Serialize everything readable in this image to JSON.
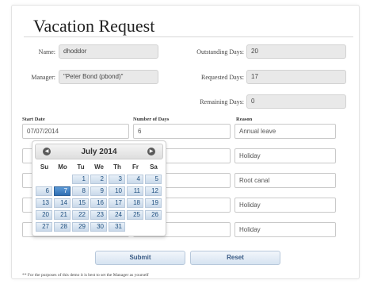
{
  "form": {
    "title": "Vacation Request",
    "name_label": "Name:",
    "name_value": "dhoddor",
    "manager_label": "Manager:",
    "manager_value": "\"Peter Bond (pbond)\"",
    "outstanding_label": "Outstanding Days:",
    "outstanding_value": "20",
    "requested_label": "Requested Days:",
    "requested_value": "17",
    "remaining_label": "Remaining Days:",
    "remaining_value": "0"
  },
  "table": {
    "headers": [
      "Start Date",
      "Number of Days",
      "Reason"
    ],
    "rows": [
      {
        "start": "07/07/2014",
        "days": "6",
        "reason": "Annual leave"
      },
      {
        "start": "",
        "days": "",
        "reason": "Holiday"
      },
      {
        "start": "",
        "days": "",
        "reason": "Root canal"
      },
      {
        "start": "",
        "days": "",
        "reason": "Holiday"
      },
      {
        "start": "",
        "days": "",
        "reason": "Holiday"
      }
    ]
  },
  "calendar": {
    "month_label": "July 2014",
    "weekdays": [
      "Su",
      "Mo",
      "Tu",
      "We",
      "Th",
      "Fr",
      "Sa"
    ],
    "weeks": [
      [
        "",
        "",
        "1",
        "2",
        "3",
        "4",
        "5"
      ],
      [
        "6",
        "7",
        "8",
        "9",
        "10",
        "11",
        "12"
      ],
      [
        "13",
        "14",
        "15",
        "16",
        "17",
        "18",
        "19"
      ],
      [
        "20",
        "21",
        "22",
        "23",
        "24",
        "25",
        "26"
      ],
      [
        "27",
        "28",
        "29",
        "30",
        "31",
        "",
        ""
      ]
    ],
    "selected_day": "7",
    "prev_icon": "◀",
    "next_icon": "▶"
  },
  "buttons": {
    "submit": "Submit",
    "reset": "Reset"
  },
  "footnote": "** For the purposes of this demo it is best to set the Manager as yourself",
  "colors": {
    "selected_day": "#2f6fb3",
    "button_text": "#3a5b85"
  }
}
